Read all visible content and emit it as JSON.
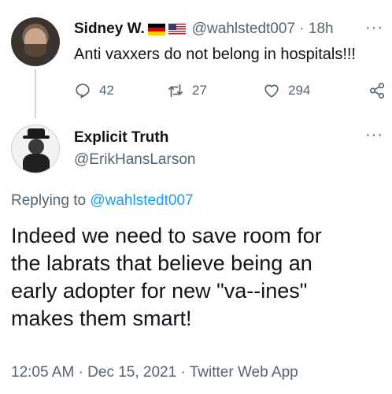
{
  "original_tweet": {
    "author_name": "Sidney W.",
    "flags": [
      "flag-germany-icon",
      "flag-usa-icon"
    ],
    "handle": "@wahlstedt007",
    "separator": "·",
    "time": "18h",
    "more": "···",
    "text": "Anti vaxxers do not belong in hospitals!!!",
    "replies": "42",
    "retweets": "27",
    "likes": "294"
  },
  "reply_tweet": {
    "author_name": "Explicit Truth",
    "handle": "@ErikHansLarson",
    "more": "···",
    "replying_prefix": "Replying to",
    "replying_to": "@wahlstedt007",
    "text_lines": [
      "Indeed we need to save room for",
      "the labrats that believe being an",
      "early adopter for new \"va--ines\"",
      "makes them smart!"
    ],
    "timestamp": "12:05 AM · Dec 15, 2021 · Twitter Web App"
  },
  "colors": {
    "text": "#0f1419",
    "secondary": "#536471",
    "link": "#1d9bf0",
    "thread_line": "#cfd9de"
  }
}
